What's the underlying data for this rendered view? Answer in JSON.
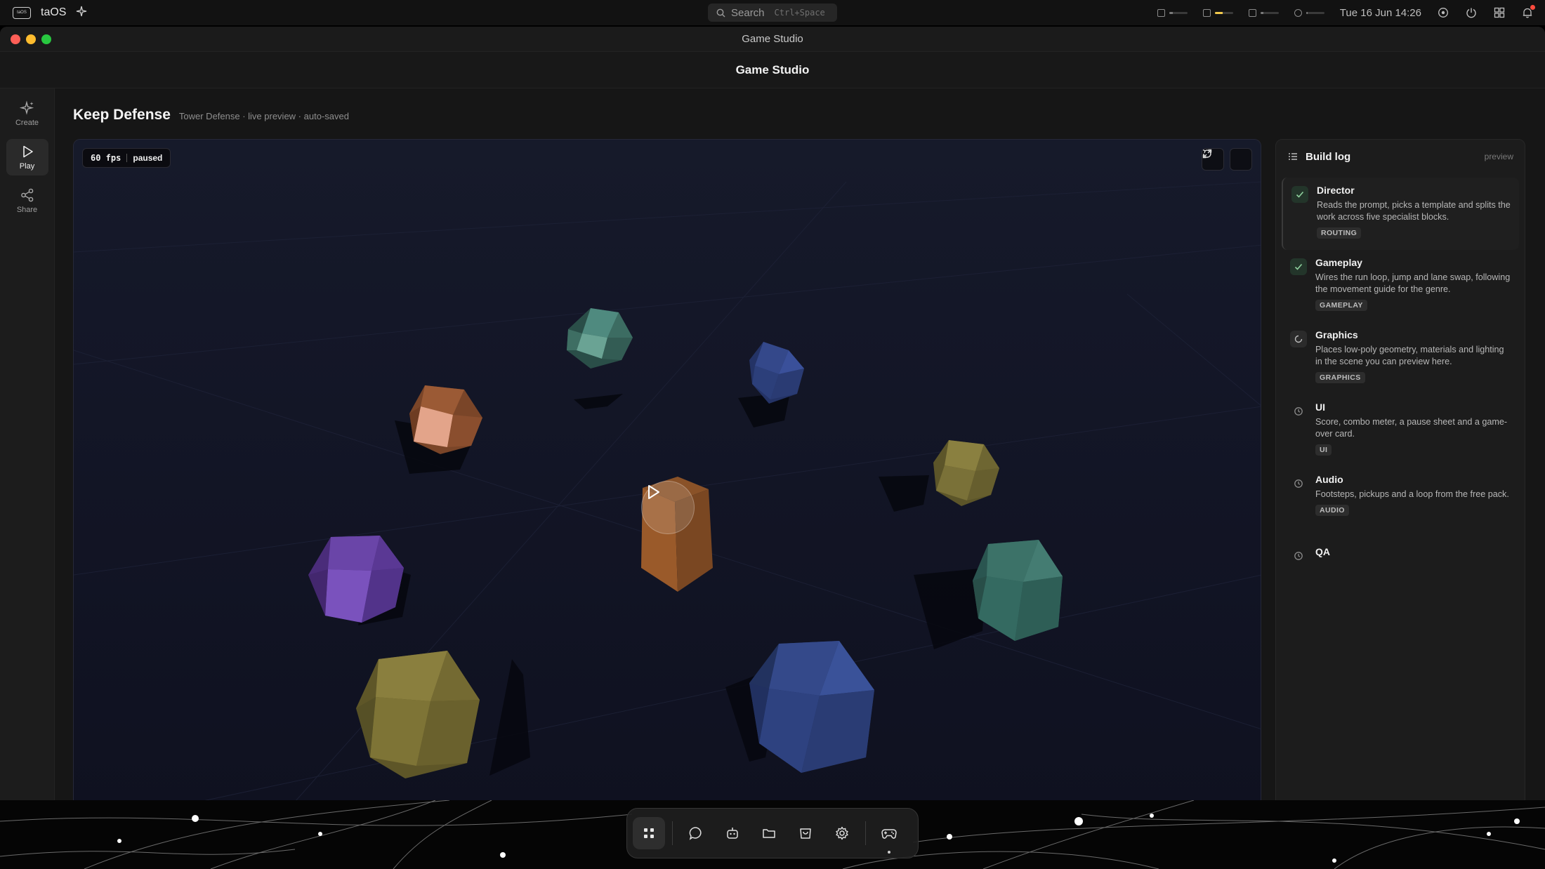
{
  "menubar": {
    "os_name": "taOS",
    "os_logo_text": "taOS",
    "search_label": "Search",
    "search_shortcut": "Ctrl+Space",
    "meters": [
      {
        "icon": "cpu-icon",
        "level": 0.2,
        "color": "#7a7a7a"
      },
      {
        "icon": "gpu-icon",
        "level": 0.45,
        "color": "#f2c94c"
      },
      {
        "icon": "memory-icon",
        "level": 0.15,
        "color": "#7a7a7a"
      },
      {
        "icon": "power-icon",
        "level": 0.1,
        "color": "#7a7a7a"
      }
    ],
    "clock": "Tue 16 Jun 14:26"
  },
  "window": {
    "title": "Game Studio",
    "app_title": "Game Studio"
  },
  "rail": {
    "items": [
      {
        "label": "Create",
        "icon": "sparkle-icon"
      },
      {
        "label": "Play",
        "icon": "play-icon",
        "active": true
      },
      {
        "label": "Share",
        "icon": "share-icon"
      }
    ]
  },
  "project": {
    "title": "Keep Defense",
    "subtitle": "Tower Defense · live preview · auto-saved"
  },
  "viewport": {
    "fps": "60 fps",
    "state": "paused",
    "background": "#121421"
  },
  "build_log": {
    "title": "Build log",
    "hint": "preview",
    "steps": [
      {
        "name": "Director",
        "desc": "Reads the prompt, picks a template and splits the work across five specialist blocks.",
        "tag": "ROUTING",
        "status": "done"
      },
      {
        "name": "Gameplay",
        "desc": "Wires the run loop, jump and lane swap, following the movement guide for the genre.",
        "tag": "GAMEPLAY",
        "status": "done"
      },
      {
        "name": "Graphics",
        "desc": "Places low-poly geometry, materials and lighting in the scene you can preview here.",
        "tag": "GRAPHICS",
        "status": "running"
      },
      {
        "name": "UI",
        "desc": "Score, combo meter, a pause sheet and a game-over card.",
        "tag": "UI",
        "status": "pending"
      },
      {
        "name": "Audio",
        "desc": "Footsteps, pickups and a loop from the free pack.",
        "tag": "AUDIO",
        "status": "pending"
      },
      {
        "name": "QA",
        "desc": "",
        "tag": "",
        "status": "pending"
      }
    ]
  },
  "dock": {
    "items": [
      "apps-grid-icon",
      "chat-icon",
      "agents-icon",
      "folder-icon",
      "store-icon",
      "settings-icon",
      "gamepad-icon"
    ]
  }
}
